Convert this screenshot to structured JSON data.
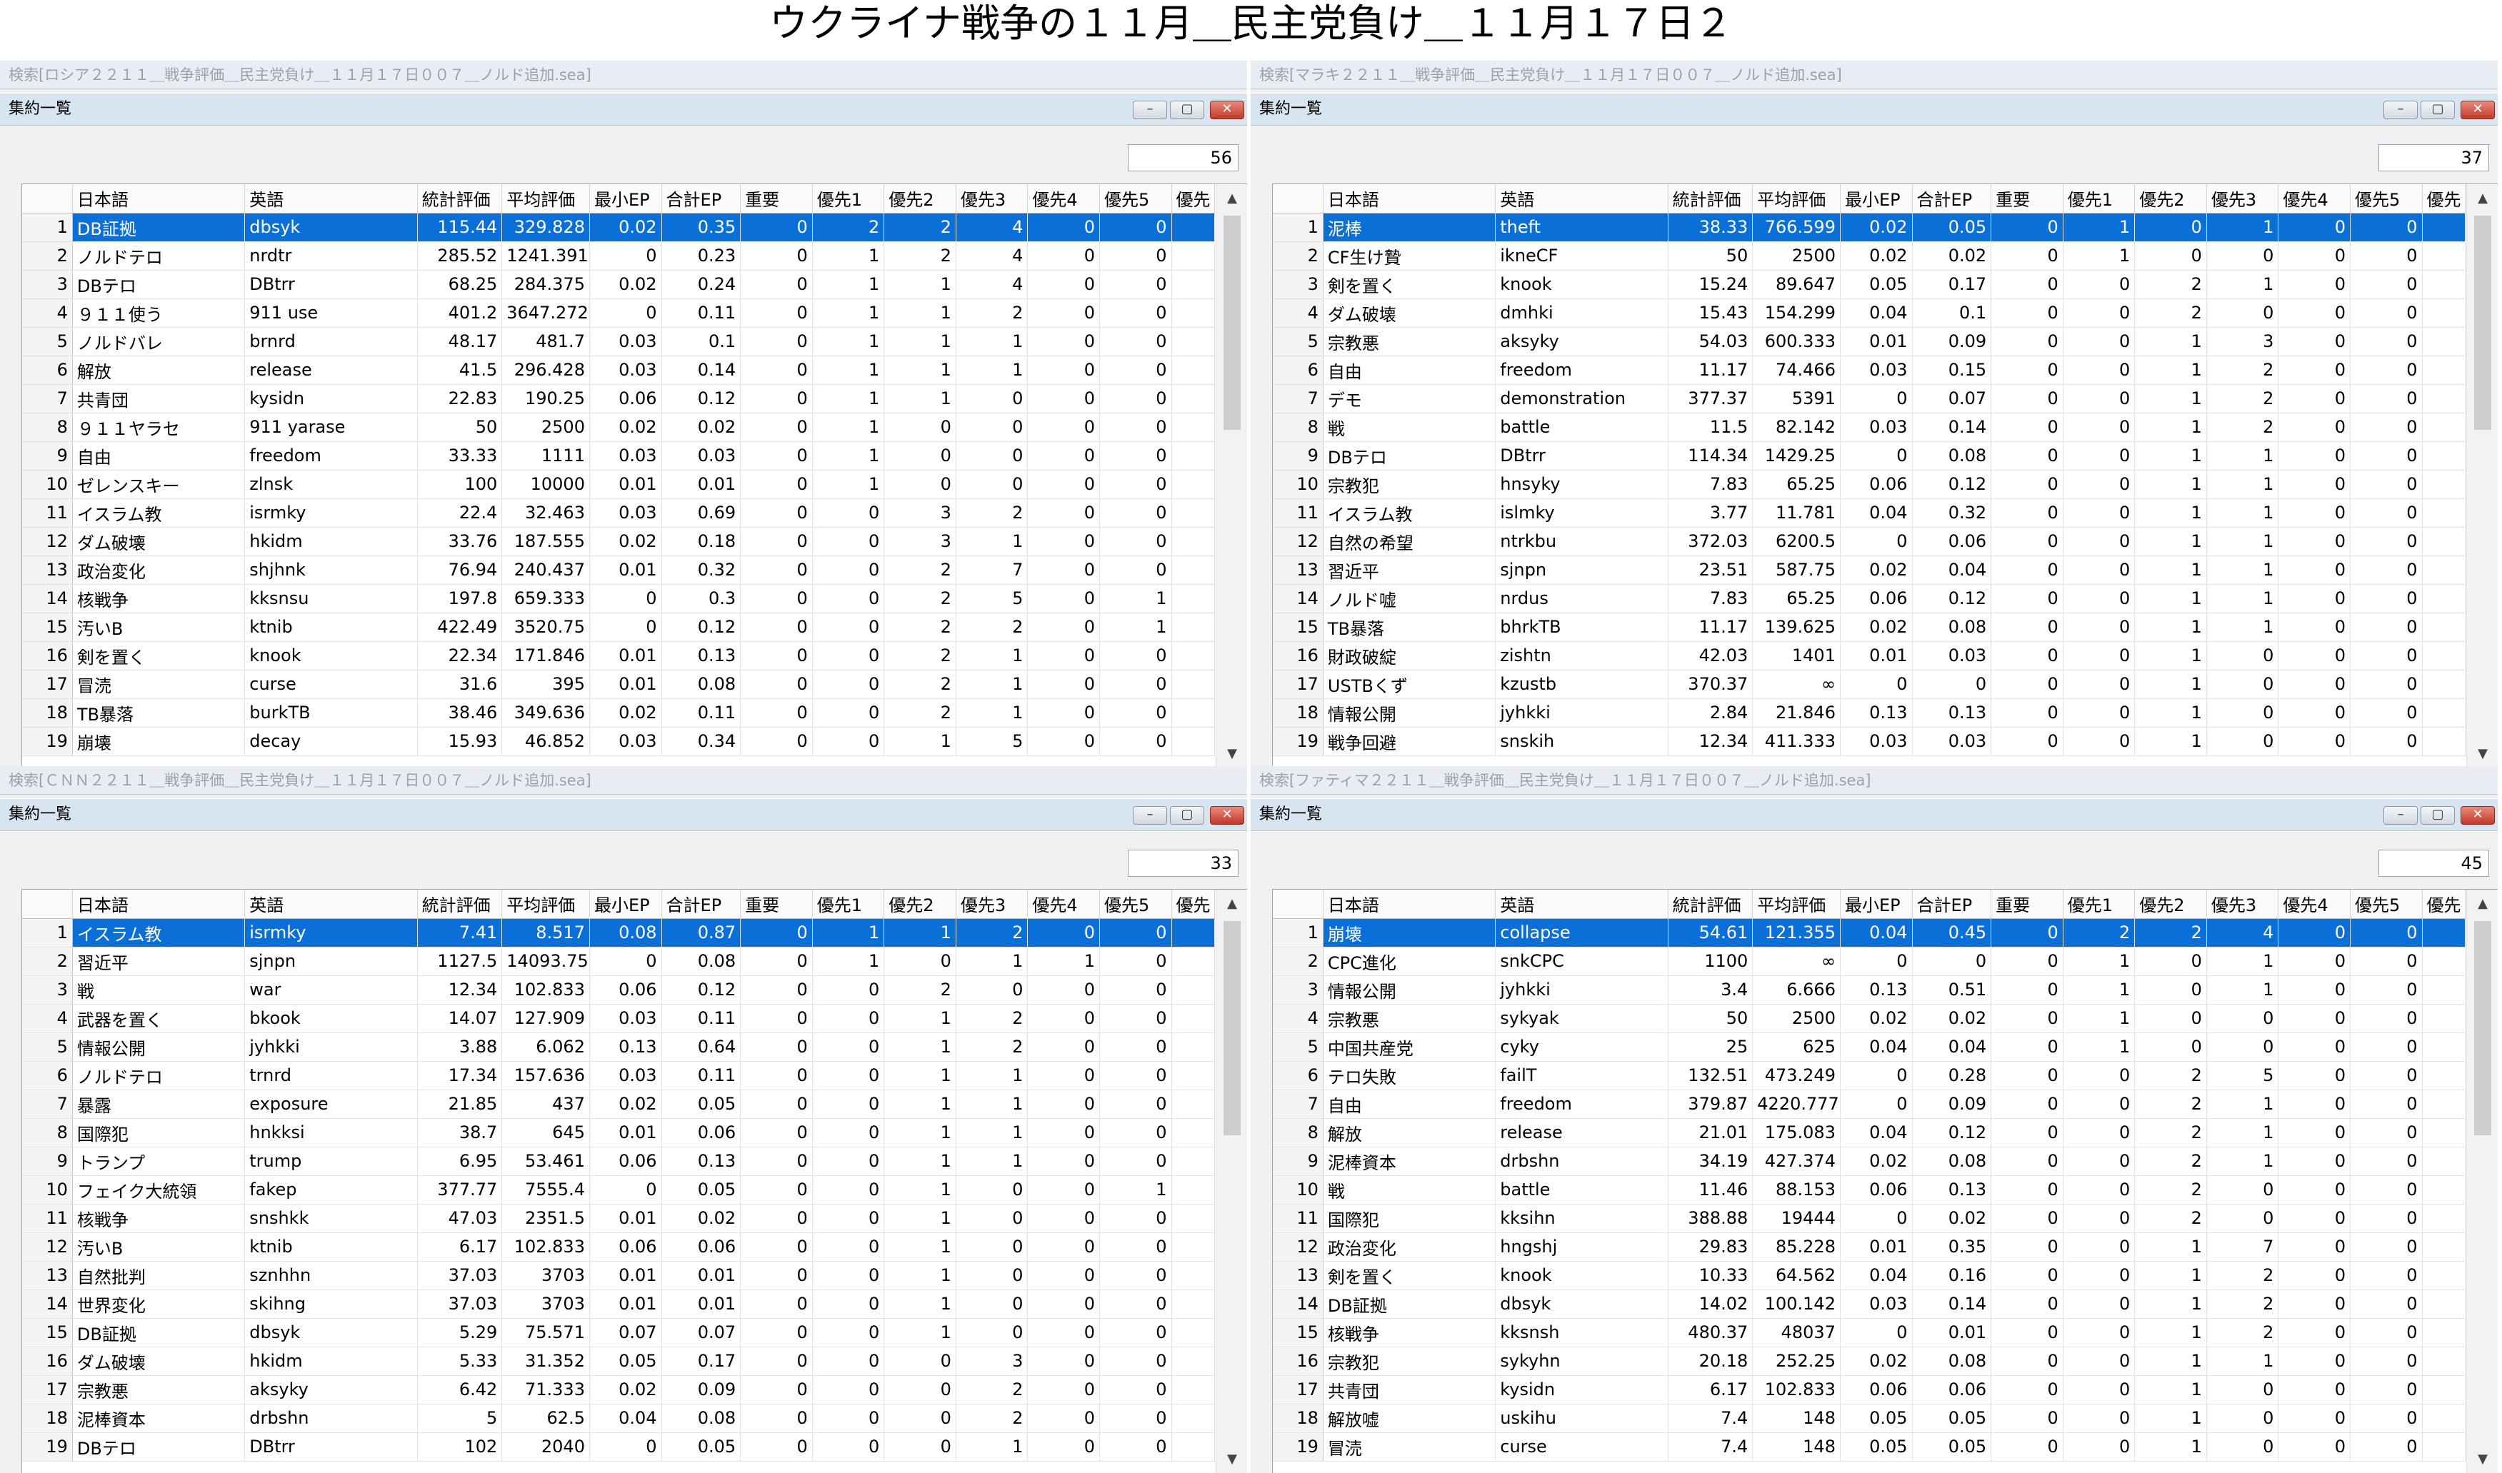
{
  "page_title": "ウクライナ戦争の１１月＿民主党負け＿１１月１７日２",
  "columns": [
    "",
    "日本語",
    "英語",
    "統計評価",
    "平均評価",
    "最小EP",
    "合計EP",
    "重要",
    "優先1",
    "優先2",
    "優先3",
    "優先4",
    "優先5",
    "優先"
  ],
  "panels": [
    {
      "search_title": "検索[ロシア２２１１＿戦争評価＿民主党負け＿１１月１７日００７＿ノルド追加.sea]",
      "window_title": "集約一覧",
      "count": "56",
      "rows": [
        [
          "1",
          "DB証拠",
          "dbsyk",
          "115.44",
          "329.828",
          "0.02",
          "0.35",
          "0",
          "2",
          "2",
          "4",
          "0",
          "0"
        ],
        [
          "2",
          "ノルドテロ",
          "nrdtr",
          "285.52",
          "1241.391",
          "0",
          "0.23",
          "0",
          "1",
          "2",
          "4",
          "0",
          "0"
        ],
        [
          "3",
          "DBテロ",
          "DBtrr",
          "68.25",
          "284.375",
          "0.02",
          "0.24",
          "0",
          "1",
          "1",
          "4",
          "0",
          "0"
        ],
        [
          "4",
          "９１１使う",
          "911 use",
          "401.2",
          "3647.272",
          "0",
          "0.11",
          "0",
          "1",
          "1",
          "2",
          "0",
          "0"
        ],
        [
          "5",
          "ノルドバレ",
          "brnrd",
          "48.17",
          "481.7",
          "0.03",
          "0.1",
          "0",
          "1",
          "1",
          "1",
          "0",
          "0"
        ],
        [
          "6",
          "解放",
          "release",
          "41.5",
          "296.428",
          "0.03",
          "0.14",
          "0",
          "1",
          "1",
          "1",
          "0",
          "0"
        ],
        [
          "7",
          "共青団",
          "kysidn",
          "22.83",
          "190.25",
          "0.06",
          "0.12",
          "0",
          "1",
          "1",
          "0",
          "0",
          "0"
        ],
        [
          "8",
          "９１１ヤラセ",
          "911 yarase",
          "50",
          "2500",
          "0.02",
          "0.02",
          "0",
          "1",
          "0",
          "0",
          "0",
          "0"
        ],
        [
          "9",
          "自由",
          "freedom",
          "33.33",
          "1111",
          "0.03",
          "0.03",
          "0",
          "1",
          "0",
          "0",
          "0",
          "0"
        ],
        [
          "10",
          "ゼレンスキー",
          "zlnsk",
          "100",
          "10000",
          "0.01",
          "0.01",
          "0",
          "1",
          "0",
          "0",
          "0",
          "0"
        ],
        [
          "11",
          "イスラム教",
          "isrmky",
          "22.4",
          "32.463",
          "0.03",
          "0.69",
          "0",
          "0",
          "3",
          "2",
          "0",
          "0"
        ],
        [
          "12",
          "ダム破壊",
          "hkidm",
          "33.76",
          "187.555",
          "0.02",
          "0.18",
          "0",
          "0",
          "3",
          "1",
          "0",
          "0"
        ],
        [
          "13",
          "政治変化",
          "shjhnk",
          "76.94",
          "240.437",
          "0.01",
          "0.32",
          "0",
          "0",
          "2",
          "7",
          "0",
          "0"
        ],
        [
          "14",
          "核戦争",
          "kksnsu",
          "197.8",
          "659.333",
          "0",
          "0.3",
          "0",
          "0",
          "2",
          "5",
          "0",
          "1"
        ],
        [
          "15",
          "汚いB",
          "ktnib",
          "422.49",
          "3520.75",
          "0",
          "0.12",
          "0",
          "0",
          "2",
          "2",
          "0",
          "1"
        ],
        [
          "16",
          "剣を置く",
          "knook",
          "22.34",
          "171.846",
          "0.01",
          "0.13",
          "0",
          "0",
          "2",
          "1",
          "0",
          "0"
        ],
        [
          "17",
          "冒涜",
          "curse",
          "31.6",
          "395",
          "0.01",
          "0.08",
          "0",
          "0",
          "2",
          "1",
          "0",
          "0"
        ],
        [
          "18",
          "TB暴落",
          "burkTB",
          "38.46",
          "349.636",
          "0.02",
          "0.11",
          "0",
          "0",
          "2",
          "1",
          "0",
          "0"
        ],
        [
          "19",
          "崩壊",
          "decay",
          "15.93",
          "46.852",
          "0.03",
          "0.34",
          "0",
          "0",
          "1",
          "5",
          "0",
          "0"
        ]
      ]
    },
    {
      "search_title": "検索[マラキ２２１１＿戦争評価＿民主党負け＿１１月１７日００７＿ノルド追加.sea]",
      "window_title": "集約一覧",
      "count": "37",
      "rows": [
        [
          "1",
          "泥棒",
          "theft",
          "38.33",
          "766.599",
          "0.02",
          "0.05",
          "0",
          "1",
          "0",
          "1",
          "0",
          "0"
        ],
        [
          "2",
          "CF生け贄",
          "ikneCF",
          "50",
          "2500",
          "0.02",
          "0.02",
          "0",
          "1",
          "0",
          "0",
          "0",
          "0"
        ],
        [
          "3",
          "剣を置く",
          "knook",
          "15.24",
          "89.647",
          "0.05",
          "0.17",
          "0",
          "0",
          "2",
          "1",
          "0",
          "0"
        ],
        [
          "4",
          "ダム破壊",
          "dmhki",
          "15.43",
          "154.299",
          "0.04",
          "0.1",
          "0",
          "0",
          "2",
          "0",
          "0",
          "0"
        ],
        [
          "5",
          "宗教悪",
          "aksyky",
          "54.03",
          "600.333",
          "0.01",
          "0.09",
          "0",
          "0",
          "1",
          "3",
          "0",
          "0"
        ],
        [
          "6",
          "自由",
          "freedom",
          "11.17",
          "74.466",
          "0.03",
          "0.15",
          "0",
          "0",
          "1",
          "2",
          "0",
          "0"
        ],
        [
          "7",
          "デモ",
          "demonstration",
          "377.37",
          "5391",
          "0",
          "0.07",
          "0",
          "0",
          "1",
          "2",
          "0",
          "0"
        ],
        [
          "8",
          "戦",
          "battle",
          "11.5",
          "82.142",
          "0.03",
          "0.14",
          "0",
          "0",
          "1",
          "2",
          "0",
          "0"
        ],
        [
          "9",
          "DBテロ",
          "DBtrr",
          "114.34",
          "1429.25",
          "0",
          "0.08",
          "0",
          "0",
          "1",
          "1",
          "0",
          "0"
        ],
        [
          "10",
          "宗教犯",
          "hnsyky",
          "7.83",
          "65.25",
          "0.06",
          "0.12",
          "0",
          "0",
          "1",
          "1",
          "0",
          "0"
        ],
        [
          "11",
          "イスラム教",
          "islmky",
          "3.77",
          "11.781",
          "0.04",
          "0.32",
          "0",
          "0",
          "1",
          "1",
          "0",
          "0"
        ],
        [
          "12",
          "自然の希望",
          "ntrkbu",
          "372.03",
          "6200.5",
          "0",
          "0.06",
          "0",
          "0",
          "1",
          "1",
          "0",
          "0"
        ],
        [
          "13",
          "習近平",
          "sjnpn",
          "23.51",
          "587.75",
          "0.02",
          "0.04",
          "0",
          "0",
          "1",
          "1",
          "0",
          "0"
        ],
        [
          "14",
          "ノルド嘘",
          "nrdus",
          "7.83",
          "65.25",
          "0.06",
          "0.12",
          "0",
          "0",
          "1",
          "1",
          "0",
          "0"
        ],
        [
          "15",
          "TB暴落",
          "bhrkTB",
          "11.17",
          "139.625",
          "0.02",
          "0.08",
          "0",
          "0",
          "1",
          "1",
          "0",
          "0"
        ],
        [
          "16",
          "財政破綻",
          "zishtn",
          "42.03",
          "1401",
          "0.01",
          "0.03",
          "0",
          "0",
          "1",
          "0",
          "0",
          "0"
        ],
        [
          "17",
          "USTBくず",
          "kzustb",
          "370.37",
          "∞",
          "0",
          "0",
          "0",
          "0",
          "1",
          "0",
          "0",
          "0"
        ],
        [
          "18",
          "情報公開",
          "jyhkki",
          "2.84",
          "21.846",
          "0.13",
          "0.13",
          "0",
          "0",
          "1",
          "0",
          "0",
          "0"
        ],
        [
          "19",
          "戦争回避",
          "snskih",
          "12.34",
          "411.333",
          "0.03",
          "0.03",
          "0",
          "0",
          "1",
          "0",
          "0",
          "0"
        ]
      ]
    },
    {
      "search_title": "検索[ＣＮＮ２２１１＿戦争評価＿民主党負け＿１１月１７日００７＿ノルド追加.sea]",
      "window_title": "集約一覧",
      "count": "33",
      "rows": [
        [
          "1",
          "イスラム教",
          "isrmky",
          "7.41",
          "8.517",
          "0.08",
          "0.87",
          "0",
          "1",
          "1",
          "2",
          "0",
          "0"
        ],
        [
          "2",
          "習近平",
          "sjnpn",
          "1127.5",
          "14093.75",
          "0",
          "0.08",
          "0",
          "1",
          "0",
          "1",
          "1",
          "0"
        ],
        [
          "3",
          "戦",
          "war",
          "12.34",
          "102.833",
          "0.06",
          "0.12",
          "0",
          "0",
          "2",
          "0",
          "0",
          "0"
        ],
        [
          "4",
          "武器を置く",
          "bkook",
          "14.07",
          "127.909",
          "0.03",
          "0.11",
          "0",
          "0",
          "1",
          "2",
          "0",
          "0"
        ],
        [
          "5",
          "情報公開",
          "jyhkki",
          "3.88",
          "6.062",
          "0.13",
          "0.64",
          "0",
          "0",
          "1",
          "2",
          "0",
          "0"
        ],
        [
          "6",
          "ノルドテロ",
          "trnrd",
          "17.34",
          "157.636",
          "0.03",
          "0.11",
          "0",
          "0",
          "1",
          "1",
          "0",
          "0"
        ],
        [
          "7",
          "暴露",
          "exposure",
          "21.85",
          "437",
          "0.02",
          "0.05",
          "0",
          "0",
          "1",
          "1",
          "0",
          "0"
        ],
        [
          "8",
          "国際犯",
          "hnkksi",
          "38.7",
          "645",
          "0.01",
          "0.06",
          "0",
          "0",
          "1",
          "1",
          "0",
          "0"
        ],
        [
          "9",
          "トランプ",
          "trump",
          "6.95",
          "53.461",
          "0.06",
          "0.13",
          "0",
          "0",
          "1",
          "1",
          "0",
          "0"
        ],
        [
          "10",
          "フェイク大統領",
          "fakep",
          "377.77",
          "7555.4",
          "0",
          "0.05",
          "0",
          "0",
          "1",
          "0",
          "0",
          "1"
        ],
        [
          "11",
          "核戦争",
          "snshkk",
          "47.03",
          "2351.5",
          "0.01",
          "0.02",
          "0",
          "0",
          "1",
          "0",
          "0",
          "0"
        ],
        [
          "12",
          "汚いB",
          "ktnib",
          "6.17",
          "102.833",
          "0.06",
          "0.06",
          "0",
          "0",
          "1",
          "0",
          "0",
          "0"
        ],
        [
          "13",
          "自然批判",
          "sznhhn",
          "37.03",
          "3703",
          "0.01",
          "0.01",
          "0",
          "0",
          "1",
          "0",
          "0",
          "0"
        ],
        [
          "14",
          "世界変化",
          "skihng",
          "37.03",
          "3703",
          "0.01",
          "0.01",
          "0",
          "0",
          "1",
          "0",
          "0",
          "0"
        ],
        [
          "15",
          "DB証拠",
          "dbsyk",
          "5.29",
          "75.571",
          "0.07",
          "0.07",
          "0",
          "0",
          "1",
          "0",
          "0",
          "0"
        ],
        [
          "16",
          "ダム破壊",
          "hkidm",
          "5.33",
          "31.352",
          "0.05",
          "0.17",
          "0",
          "0",
          "0",
          "3",
          "0",
          "0"
        ],
        [
          "17",
          "宗教悪",
          "aksyky",
          "6.42",
          "71.333",
          "0.02",
          "0.09",
          "0",
          "0",
          "0",
          "2",
          "0",
          "0"
        ],
        [
          "18",
          "泥棒資本",
          "drbshn",
          "5",
          "62.5",
          "0.04",
          "0.08",
          "0",
          "0",
          "0",
          "2",
          "0",
          "0"
        ],
        [
          "19",
          "DBテロ",
          "DBtrr",
          "102",
          "2040",
          "0",
          "0.05",
          "0",
          "0",
          "0",
          "1",
          "0",
          "0"
        ]
      ]
    },
    {
      "search_title": "検索[ファティマ２２１１＿戦争評価＿民主党負け＿１１月１７日００７＿ノルド追加.sea]",
      "window_title": "集約一覧",
      "count": "45",
      "rows": [
        [
          "1",
          "崩壊",
          "collapse",
          "54.61",
          "121.355",
          "0.04",
          "0.45",
          "0",
          "2",
          "2",
          "4",
          "0",
          "0"
        ],
        [
          "2",
          "CPC進化",
          "snkCPC",
          "1100",
          "∞",
          "0",
          "0",
          "0",
          "1",
          "0",
          "1",
          "0",
          "0"
        ],
        [
          "3",
          "情報公開",
          "jyhkki",
          "3.4",
          "6.666",
          "0.13",
          "0.51",
          "0",
          "1",
          "0",
          "1",
          "0",
          "0"
        ],
        [
          "4",
          "宗教悪",
          "sykyak",
          "50",
          "2500",
          "0.02",
          "0.02",
          "0",
          "1",
          "0",
          "0",
          "0",
          "0"
        ],
        [
          "5",
          "中国共産党",
          "cyky",
          "25",
          "625",
          "0.04",
          "0.04",
          "0",
          "1",
          "0",
          "0",
          "0",
          "0"
        ],
        [
          "6",
          "テロ失敗",
          "failT",
          "132.51",
          "473.249",
          "0",
          "0.28",
          "0",
          "0",
          "2",
          "5",
          "0",
          "0"
        ],
        [
          "7",
          "自由",
          "freedom",
          "379.87",
          "4220.777",
          "0",
          "0.09",
          "0",
          "0",
          "2",
          "1",
          "0",
          "0"
        ],
        [
          "8",
          "解放",
          "release",
          "21.01",
          "175.083",
          "0.04",
          "0.12",
          "0",
          "0",
          "2",
          "1",
          "0",
          "0"
        ],
        [
          "9",
          "泥棒資本",
          "drbshn",
          "34.19",
          "427.374",
          "0.02",
          "0.08",
          "0",
          "0",
          "2",
          "1",
          "0",
          "0"
        ],
        [
          "10",
          "戦",
          "battle",
          "11.46",
          "88.153",
          "0.06",
          "0.13",
          "0",
          "0",
          "2",
          "0",
          "0",
          "0"
        ],
        [
          "11",
          "国際犯",
          "kksihn",
          "388.88",
          "19444",
          "0",
          "0.02",
          "0",
          "0",
          "2",
          "0",
          "0",
          "0"
        ],
        [
          "12",
          "政治変化",
          "hngshj",
          "29.83",
          "85.228",
          "0.01",
          "0.35",
          "0",
          "0",
          "1",
          "7",
          "0",
          "0"
        ],
        [
          "13",
          "剣を置く",
          "knook",
          "10.33",
          "64.562",
          "0.04",
          "0.16",
          "0",
          "0",
          "1",
          "2",
          "0",
          "0"
        ],
        [
          "14",
          "DB証拠",
          "dbsyk",
          "14.02",
          "100.142",
          "0.03",
          "0.14",
          "0",
          "0",
          "1",
          "2",
          "0",
          "0"
        ],
        [
          "15",
          "核戦争",
          "kksnsh",
          "480.37",
          "48037",
          "0",
          "0.01",
          "0",
          "0",
          "1",
          "2",
          "0",
          "0"
        ],
        [
          "16",
          "宗教犯",
          "sykyhn",
          "20.18",
          "252.25",
          "0.02",
          "0.08",
          "0",
          "0",
          "1",
          "1",
          "0",
          "0"
        ],
        [
          "17",
          "共青団",
          "kysidn",
          "6.17",
          "102.833",
          "0.06",
          "0.06",
          "0",
          "0",
          "1",
          "0",
          "0",
          "0"
        ],
        [
          "18",
          "解放嘘",
          "uskihu",
          "7.4",
          "148",
          "0.05",
          "0.05",
          "0",
          "0",
          "1",
          "0",
          "0",
          "0"
        ],
        [
          "19",
          "冒涜",
          "curse",
          "7.4",
          "148",
          "0.05",
          "0.05",
          "0",
          "0",
          "1",
          "0",
          "0",
          "0"
        ]
      ]
    }
  ]
}
